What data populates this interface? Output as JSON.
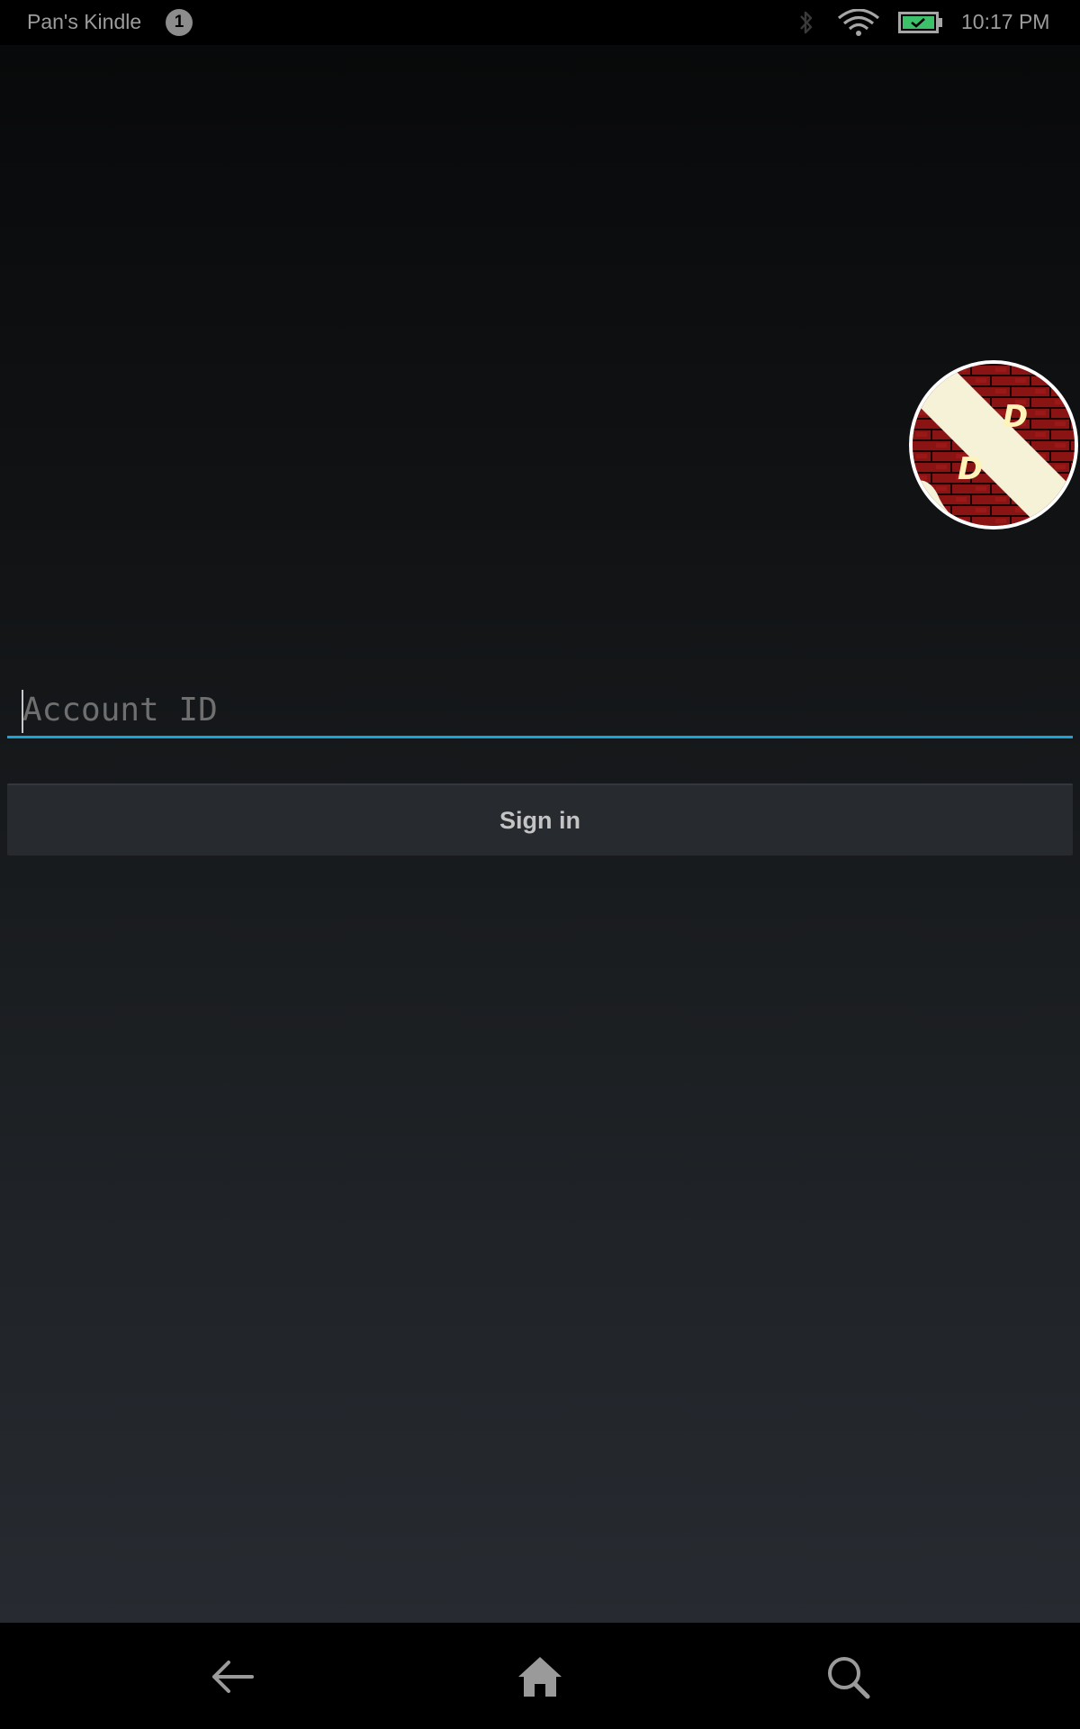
{
  "status_bar": {
    "device_name": "Pan's Kindle",
    "notification_count": "1",
    "icons": [
      "bluetooth-icon",
      "wifi-icon",
      "battery-icon"
    ],
    "time": "10:17 PM"
  },
  "avatar": {
    "icon": "user-avatar-image",
    "letters": [
      "D",
      "D"
    ]
  },
  "login": {
    "account_placeholder": "Account ID",
    "account_value": "",
    "sign_in_label": "Sign in"
  },
  "nav_bar": {
    "icons": [
      "back-arrow-icon",
      "home-icon",
      "search-icon"
    ]
  },
  "colors": {
    "accent": "#1aa3d8",
    "battery": "#3cc06a",
    "button_bg": "#272a2f"
  }
}
